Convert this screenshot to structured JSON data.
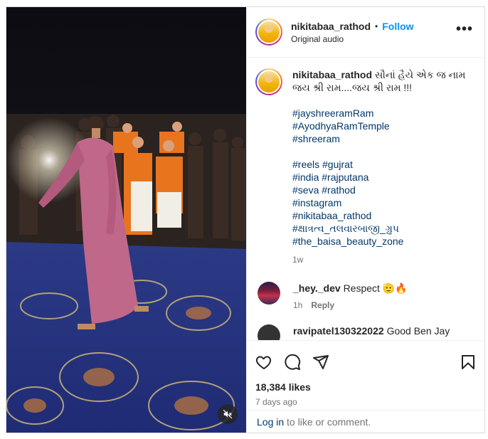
{
  "post": {
    "username": "nikitabaa_rathod",
    "separator": "•",
    "follow_label": "Follow",
    "audio_label": "Original audio",
    "more_label": "•••"
  },
  "caption": {
    "username": "nikitabaa_rathod",
    "text_line1": "સૌનાં હૈયે એક જ નામ",
    "text_line2": "જય શ્રી રામ....જય શ્રી રામ !!!",
    "hashtags": [
      "#jayshreeramRam",
      "#AyodhyaRamTemple",
      "#shreeram",
      "",
      "#reels #gujrat",
      "#india #rajputana",
      "#seva #rathod",
      "#instagram",
      "#nikitabaa_rathod",
      "#ક્ષાત્રત્વ_તલવારબાજી_ગ્રુપ",
      "#the_baisa_beauty_zone"
    ],
    "time": "1w"
  },
  "comments": [
    {
      "username": "_hey._dev",
      "text": "Respect 🫡🔥",
      "time": "1h",
      "reply_label": "Reply"
    },
    {
      "username": "ravipatel130322022",
      "text": "Good Ben Jay Shree"
    }
  ],
  "actions": {
    "likes": "18,384 likes",
    "post_time": "7 days ago"
  },
  "login_bar": {
    "login_label": "Log in",
    "suffix": " to like or comment."
  },
  "colors": {
    "link": "#00376b",
    "follow": "#0095f6",
    "muted": "#737373"
  }
}
